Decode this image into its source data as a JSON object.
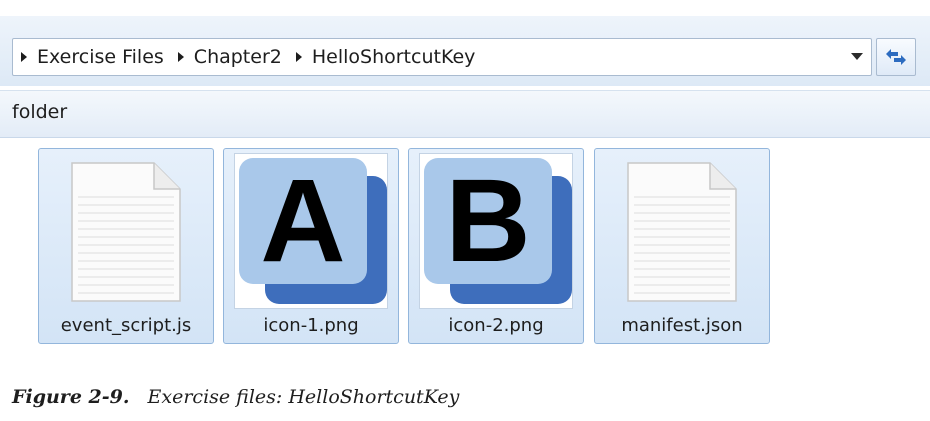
{
  "address_bar": {
    "breadcrumbs": [
      {
        "label": "Exercise Files"
      },
      {
        "label": "Chapter2"
      },
      {
        "label": "HelloShortcutKey"
      }
    ],
    "dropdown_icon": "chevron-down-icon",
    "refresh_icon": "refresh-icon"
  },
  "toolbar": {
    "item_label": "folder"
  },
  "files": [
    {
      "name": "event_script.js",
      "kind": "document",
      "icon": "text-document-icon"
    },
    {
      "name": "icon-1.png",
      "kind": "image",
      "icon": "image-thumbnail",
      "letter": "A"
    },
    {
      "name": "icon-2.png",
      "kind": "image",
      "icon": "image-thumbnail",
      "letter": "B"
    },
    {
      "name": "manifest.json",
      "kind": "document",
      "icon": "text-document-icon"
    }
  ],
  "caption": {
    "number": "Figure 2-9.",
    "text": "Exercise files: HelloShortcutKey"
  },
  "colors": {
    "tile_selected": "#d3e4f6",
    "tile_border": "#93b6dc",
    "thumbnail_front": "#a9c8ea",
    "thumbnail_back": "#3e6ebc"
  }
}
